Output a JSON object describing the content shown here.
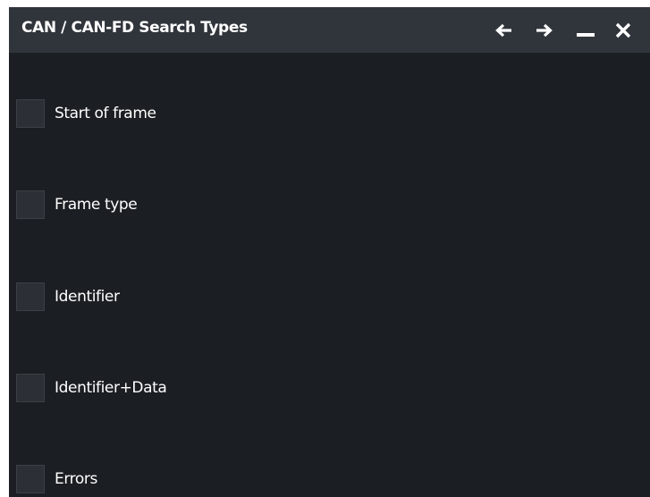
{
  "dialog": {
    "title": "CAN / CAN-FD Search Types",
    "controls": {
      "back_icon": "arrow-left-icon",
      "forward_icon": "arrow-right-icon",
      "minimize_icon": "minimize-icon",
      "close_icon": "close-icon"
    }
  },
  "search_types": [
    {
      "label": "Start of frame",
      "checked": false
    },
    {
      "label": "Frame type",
      "checked": false
    },
    {
      "label": "Identifier",
      "checked": false
    },
    {
      "label": "Identifier+Data",
      "checked": false
    },
    {
      "label": "Errors",
      "checked": false
    }
  ],
  "colors": {
    "titlebar_bg": "#30353b",
    "panel_bg": "#1b1e22",
    "checkbox_bg": "#2c3036",
    "text": "#ffffff"
  }
}
